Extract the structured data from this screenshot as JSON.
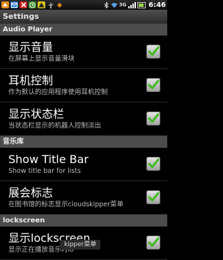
{
  "status_bar": {
    "left_icons": [
      "app-icon",
      "email-icon",
      "cancel-icon",
      "clock-icon",
      "warning-icon",
      "usb-icon",
      "debug-icon"
    ],
    "right_icons": [
      "bluetooth-icon",
      "wifi-icon",
      "network-icon",
      "signal-icon",
      "battery-icon"
    ],
    "time": "6:46",
    "network_label": "3G"
  },
  "title_bar": {
    "title": "Settings"
  },
  "sections": [
    {
      "header": "Audio Player",
      "items": [
        {
          "title": "显示音量",
          "subtitle": "在屏幕上显示音量滑块",
          "checked": true
        },
        {
          "title": "耳机控制",
          "subtitle": "作为默认的应用程序使用耳机控制",
          "checked": true
        },
        {
          "title": "显示状态栏",
          "subtitle": "当状态栏显示的机器人控制淡出",
          "checked": true
        }
      ]
    },
    {
      "header": "音乐库",
      "items": [
        {
          "title": "Show Title Bar",
          "subtitle": "Show title bar for lists",
          "checked": true
        },
        {
          "title": "展会标志",
          "subtitle": "在图书馆的标志显示cloudskipper菜单",
          "checked": true
        }
      ]
    },
    {
      "header": "lockscreen",
      "items": [
        {
          "title": "显示lockscreen",
          "subtitle": "显示正在播放音乐时lo",
          "checked": true
        }
      ]
    }
  ],
  "toast": {
    "text": "kipper菜单"
  },
  "colors": {
    "section_bg": "#4c4c4c",
    "check_green": "#3dbb1c",
    "background": "#000000"
  }
}
